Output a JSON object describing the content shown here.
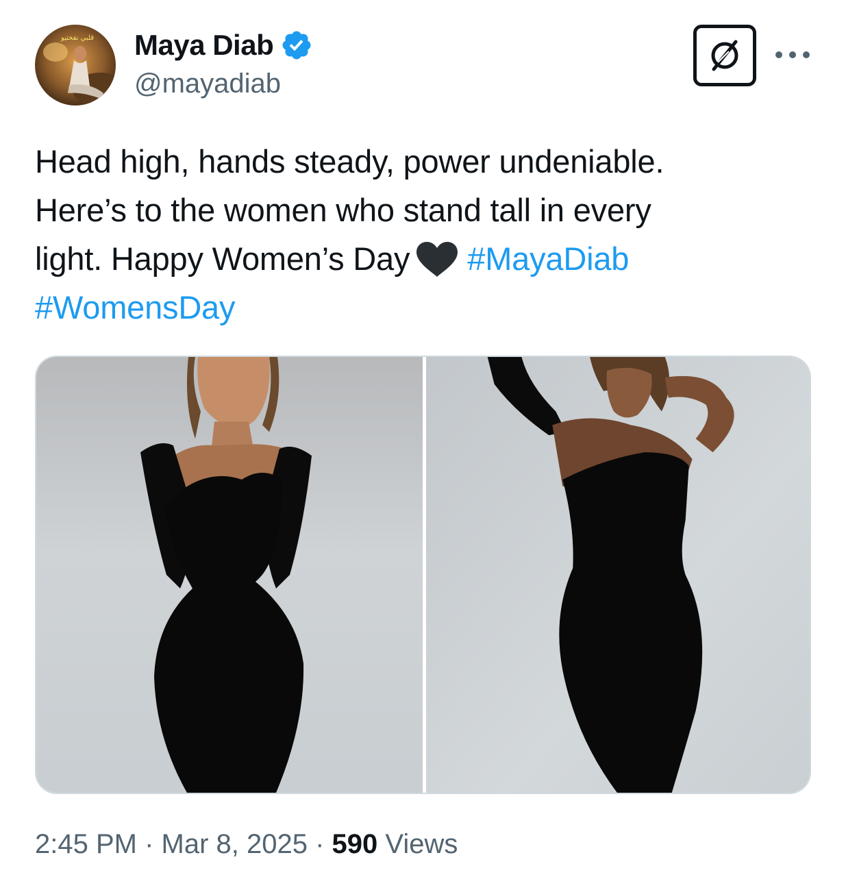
{
  "author": {
    "name": "Maya Diab",
    "handle": "@mayadiab",
    "verified": true,
    "verified_color": "#1d9bf0",
    "avatar_text": "قلبي نفختيو"
  },
  "header": {
    "grok_icon": "grok-icon",
    "more_icon": "more-icon"
  },
  "tweet": {
    "line1": "Head high, hands steady, power undeniable.",
    "line2": "Here’s to the women who stand tall in every",
    "line3_text": "light. Happy Women’s Day",
    "heart_icon": "black-heart-icon",
    "hashtag1": "#MayaDiab",
    "hashtag2": "#WomensDay",
    "hashtag_color": "#1d9bf0"
  },
  "media": {
    "photos": [
      {
        "name": "photo-1"
      },
      {
        "name": "photo-2"
      }
    ]
  },
  "meta": {
    "time": "2:45 PM",
    "separator": " · ",
    "date": "Mar 8, 2025",
    "views_count": "590",
    "views_label": " Views"
  }
}
